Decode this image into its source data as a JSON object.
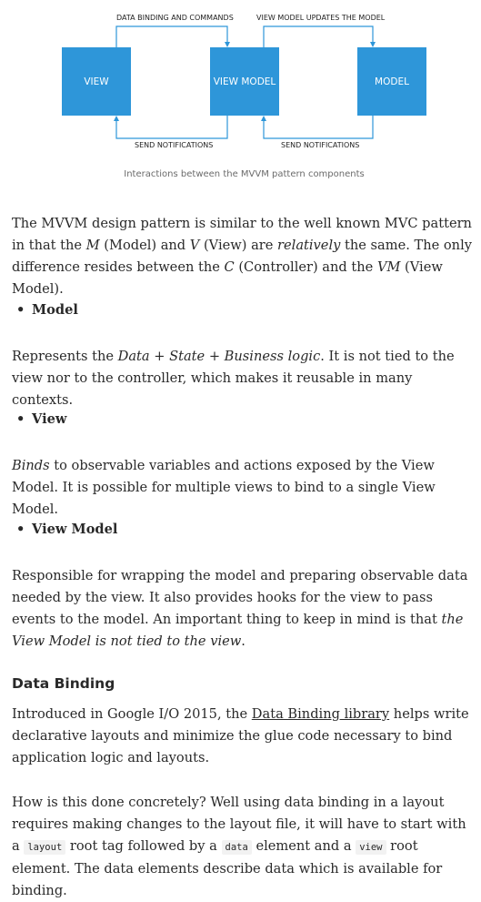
{
  "diagram": {
    "labels": {
      "top_left": "DATA BINDING AND COMMANDS",
      "top_right": "VIEW MODEL UPDATES THE MODEL",
      "bottom_left": "SEND NOTIFICATIONS",
      "bottom_right": "SEND NOTIFICATIONS"
    },
    "boxes": {
      "view": "VIEW",
      "view_model": "VIEW MODEL",
      "model": "MODEL"
    },
    "box_color": "#2e96d9",
    "caption": "Interactions between the MVVM pattern components"
  },
  "intro": {
    "t1": "The MVVM design pattern is similar to the well known MVC pattern in that the ",
    "m": "M",
    "t2": " (Model) and ",
    "v": "V",
    "t3": " (View) are ",
    "relatively": "relatively",
    "t4": " the same. The only difference resides between the ",
    "c": "C",
    "t5": " (Controller) and the ",
    "vm": "VM",
    "t6": " (View Model)."
  },
  "bullets": {
    "model": "Model",
    "view": "View",
    "view_model": "View Model"
  },
  "model_para": {
    "t1": "Represents the ",
    "italic": "Data + State + Business logic",
    "t2": ". It is not tied to the view nor to the controller, which makes it reusable in many contexts."
  },
  "view_para": {
    "italic": "Binds",
    "t1": " to observable variables and actions exposed by the View Model. It is possible for multiple views to bind to a single View Model."
  },
  "viewmodel_para": {
    "t1": "Responsible for wrapping the model and preparing observable data needed by the view. It also provides hooks for the view to pass events to the model. An important thing to keep in mind is that ",
    "italic": "the View Model is not tied to the view",
    "t2": "."
  },
  "heading": "Data Binding",
  "databinding_para": {
    "t1": "Introduced in Google I/O 2015, the ",
    "link": "Data Binding library",
    "t2": " helps write declarative layouts and minimize the glue code necessary to bind application logic and layouts."
  },
  "how_para": {
    "t1": "How is this done concretely? Well using data binding in a layout requires making changes to the layout file, it will have to start with a ",
    "code1": "layout",
    "t2": " root tag followed by a ",
    "code2": "data",
    "t3": " element and a ",
    "code3": "view",
    "t4": " root element. The data elements describe data which is available for binding."
  }
}
